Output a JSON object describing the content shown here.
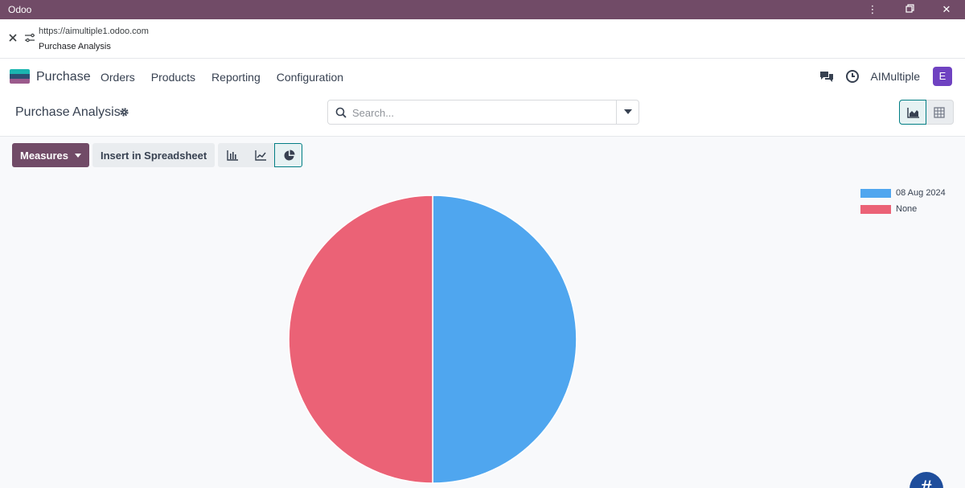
{
  "window": {
    "title": "Odoo"
  },
  "browser": {
    "url": "https://aimultiple1.odoo.com",
    "page_title": "Purchase Analysis"
  },
  "app": {
    "name": "Purchase",
    "menu": [
      "Orders",
      "Products",
      "Reporting",
      "Configuration"
    ],
    "company": "AIMultiple",
    "avatar_letter": "E"
  },
  "control": {
    "page_title": "Purchase Analysis",
    "search_placeholder": "Search..."
  },
  "toolbar": {
    "measures_label": "Measures",
    "insert_label": "Insert in Spreadsheet"
  },
  "colors": {
    "brand": "#714b67",
    "accent": "#017e84",
    "avatar": "#6f42c1"
  },
  "chart_data": {
    "type": "pie",
    "categories": [
      "08 Aug 2024",
      "None"
    ],
    "values": [
      50,
      50
    ],
    "colors": [
      "#4fa6ef",
      "#eb6276"
    ],
    "legend_position": "top-right"
  }
}
